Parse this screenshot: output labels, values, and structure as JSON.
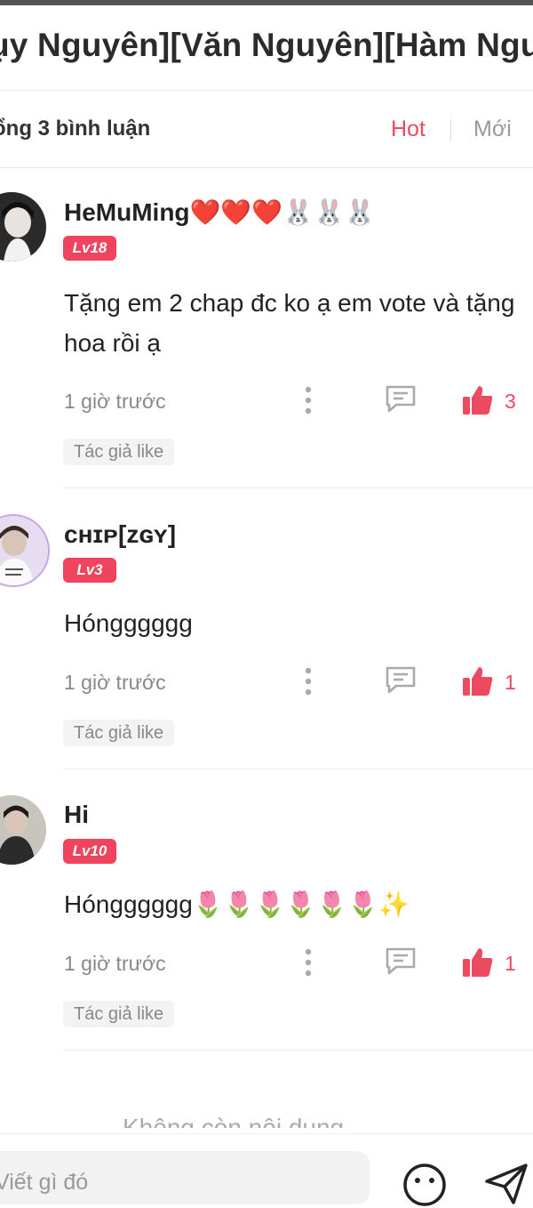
{
  "header": {
    "title": "ụy Nguyên][Văn Nguyên][Hàm Ngu"
  },
  "comments_bar": {
    "count_label": "ổng 3 bình luận",
    "sort_hot": "Hot",
    "sort_new": "Mới"
  },
  "comments": [
    {
      "username": "HeMuMing❤️❤️❤️🐰🐰🐰",
      "level": "Lv18",
      "text": "Tặng em 2 chap đc ko ạ em vote và tặng hoa rồi ạ",
      "time": "1 giờ trước",
      "likes": "3",
      "author_like": "Tác giả like"
    },
    {
      "username": "ᴄʜɪᴘ[ᴢɢʏ]",
      "level": "Lv3",
      "text": "Hóngggggg",
      "time": "1 giờ trước",
      "likes": "1",
      "author_like": "Tác giả like"
    },
    {
      "username": "Hi",
      "level": "Lv10",
      "text": "Hóngggggg🌷🌷🌷🌷🌷🌷✨",
      "time": "1 giờ trước",
      "likes": "1",
      "author_like": "Tác giả like"
    }
  ],
  "footer": {
    "end_text": "Không còn nội dung",
    "input_placeholder": "Viết gì đó"
  },
  "colors": {
    "accent": "#ec4a5f",
    "level_badge": "#f0435d",
    "muted_text": "#888888"
  },
  "icons": [
    "more-vertical-icon",
    "comment-icon",
    "thumbs-up-icon",
    "emoji-icon",
    "send-icon"
  ]
}
